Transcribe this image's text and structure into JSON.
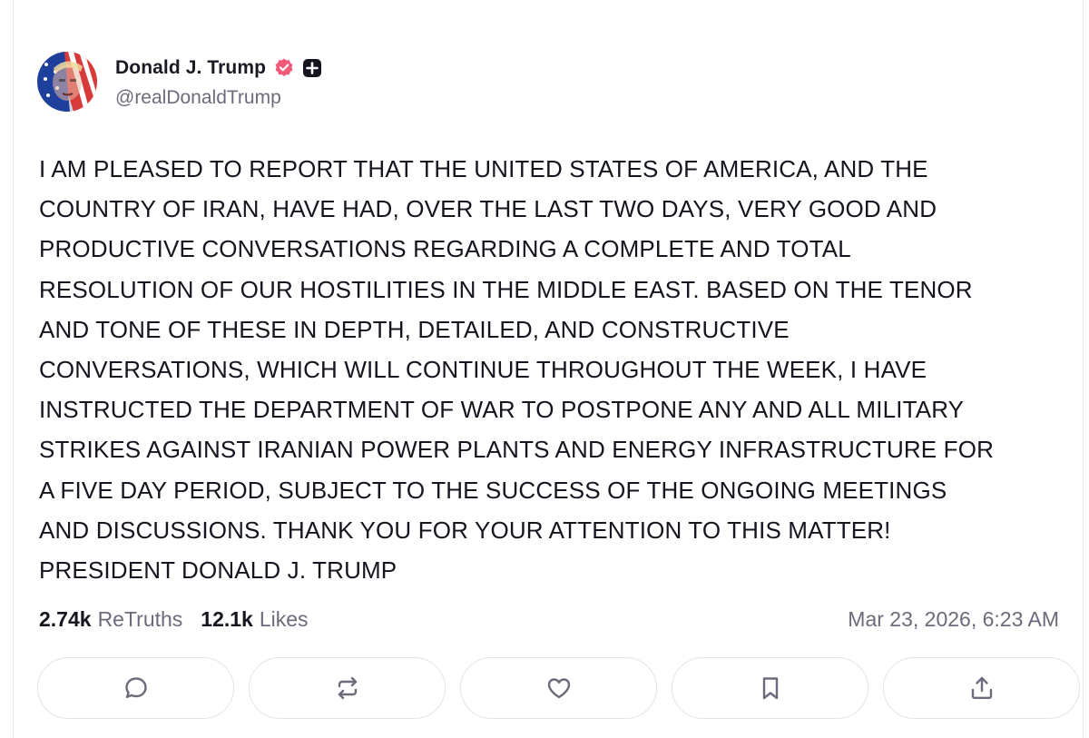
{
  "author": {
    "display_name": "Donald J. Trump",
    "handle": "@realDonaldTrump",
    "verified_color": "#f05a79",
    "icons": [
      "verified-badge-icon",
      "plus-badge-icon"
    ]
  },
  "post": {
    "lines": [
      "I AM PLEASED TO REPORT THAT THE UNITED STATES OF AMERICA, AND THE",
      "COUNTRY OF IRAN, HAVE HAD, OVER THE LAST TWO DAYS, VERY GOOD AND",
      "PRODUCTIVE CONVERSATIONS REGARDING A COMPLETE AND TOTAL",
      "RESOLUTION OF OUR HOSTILITIES IN THE MIDDLE EAST. BASED ON THE TENOR",
      "AND TONE OF THESE IN DEPTH, DETAILED, AND CONSTRUCTIVE",
      "CONVERSATIONS, WHICH WILL CONTINUE THROUGHOUT THE WEEK, I HAVE",
      "INSTRUCTED THE DEPARTMENT OF WAR TO POSTPONE ANY AND ALL MILITARY",
      "STRIKES AGAINST IRANIAN POWER PLANTS AND ENERGY INFRASTRUCTURE FOR",
      "A FIVE DAY PERIOD, SUBJECT TO THE SUCCESS OF THE ONGOING MEETINGS",
      "AND DISCUSSIONS. THANK YOU FOR YOUR ATTENTION TO THIS MATTER!",
      "PRESIDENT DONALD J. TRUMP"
    ]
  },
  "stats": {
    "retruths_count": "2.74k",
    "retruths_label": "ReTruths",
    "likes_count": "12.1k",
    "likes_label": "Likes"
  },
  "timestamp": "Mar 23, 2026, 6:23 AM",
  "actions": [
    "comment-icon",
    "retruth-icon",
    "like-icon",
    "bookmark-icon",
    "share-icon"
  ],
  "colors": {
    "text": "#15151f",
    "muted": "#6b6b7b",
    "border": "#e2e2e8",
    "icon": "#6b6b7b"
  }
}
